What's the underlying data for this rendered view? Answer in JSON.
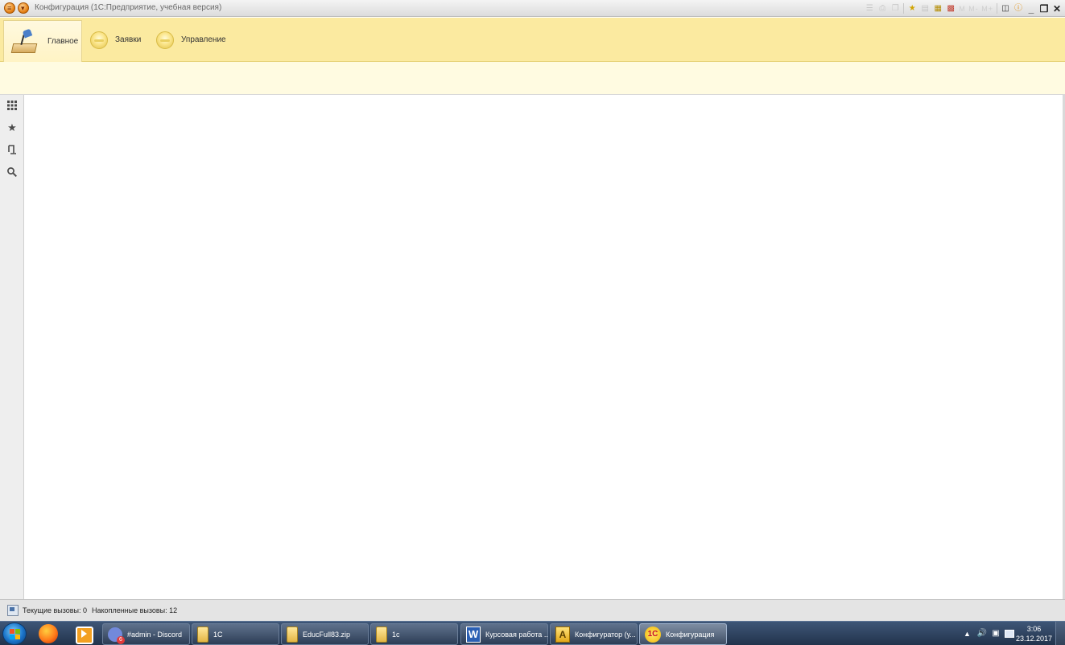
{
  "window": {
    "title": "Конфигурация  (1С:Предприятие, учебная версия)",
    "menu_icon": "menu-circle-icon",
    "back_icon": "down-arrow-circle-icon",
    "toolbar_icons": [
      "list-icon",
      "print-icon",
      "copy-icon",
      "favorites-icon",
      "document-icon",
      "calculator-icon",
      "calendar-icon",
      "info-icon",
      "minimize-icon",
      "restore-icon",
      "close-icon"
    ],
    "memory_display": "M M- M+"
  },
  "sections": [
    {
      "label": "Главное",
      "icon": "desk-lamp-icon",
      "active": true
    },
    {
      "label": "Заявки",
      "icon": "section-bulb-icon",
      "active": false
    },
    {
      "label": "Управление",
      "icon": "section-bulb-icon",
      "active": false
    }
  ],
  "left_toolbar": [
    {
      "name": "all-functions-icon",
      "glyph": "⠿"
    },
    {
      "name": "favorites-star-icon",
      "glyph": "★"
    },
    {
      "name": "history-icon",
      "glyph": "⎘"
    },
    {
      "name": "search-icon",
      "glyph": "🔍"
    }
  ],
  "statusbar": {
    "current_calls": "Текущие вызовы: 0",
    "accumulated_calls": "Накопленные вызовы: 12"
  },
  "taskbar": {
    "tasks": [
      {
        "label": "#admin - Discord",
        "icon": "discord-icon"
      },
      {
        "label": "1C",
        "icon": "folder-icon"
      },
      {
        "label": "EducFull83.zip",
        "icon": "folder-icon"
      },
      {
        "label": "1c",
        "icon": "folder-icon"
      },
      {
        "label": "Курсовая работа ...",
        "icon": "word-icon"
      },
      {
        "label": "Конфигуратор (у...",
        "icon": "configurator-icon"
      },
      {
        "label": "Конфигурация",
        "icon": "1c-icon"
      }
    ],
    "clock_time": "3:06",
    "clock_date": "23.12.2017"
  }
}
